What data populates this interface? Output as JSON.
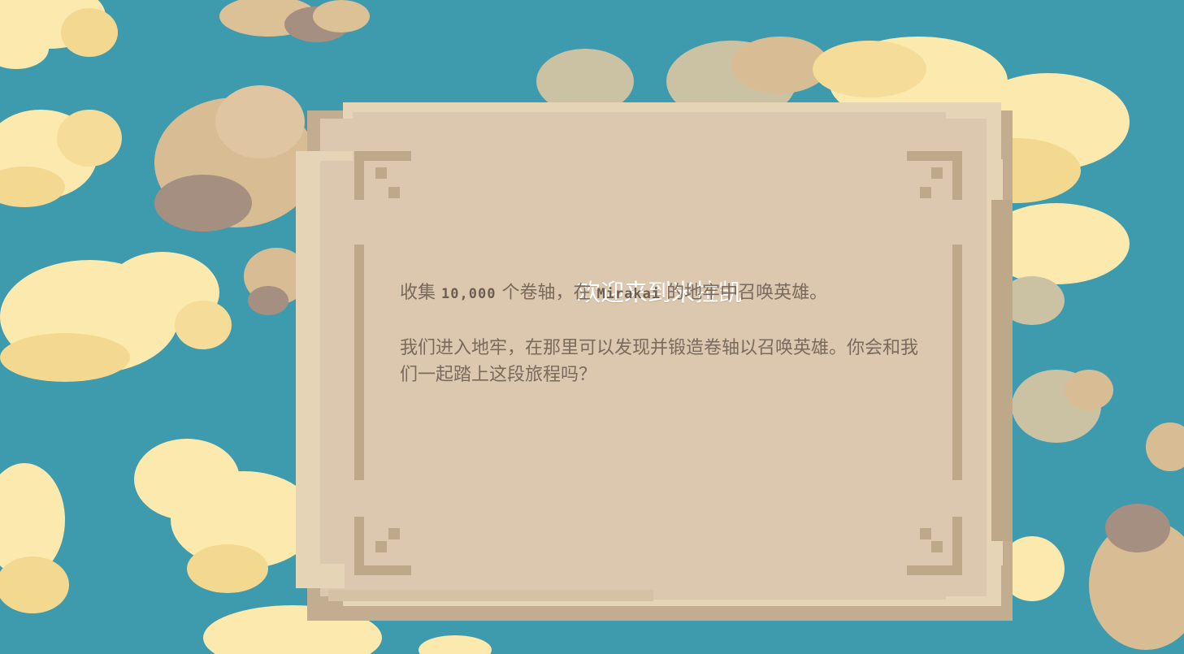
{
  "dialog": {
    "title": "欢迎来到米拉凯",
    "intro": {
      "prefix": "收集",
      "count": "10,000",
      "middle": "个卷轴，在",
      "name": "Mirakai",
      "suffix": "的地牢中召唤英雄。"
    },
    "paragraph2": "我们进入地牢，在那里可以发现并锻造卷轴以召唤英雄。你会和我们一起踏上这段旅程吗？"
  },
  "colors": {
    "sky": "#3e9aad",
    "cloud_light": "#fbe9ad",
    "cloud_tan": "#dcc196",
    "parchment": "#dbc8ae",
    "parchment_border": "#c3ad90",
    "title_text": "#ffffff",
    "body_text": "#7a6a5c"
  },
  "icons": [
    "cloud-icon",
    "scroll-corner-ornament-icon"
  ]
}
